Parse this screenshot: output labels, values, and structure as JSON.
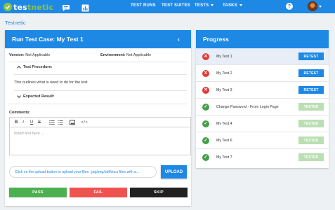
{
  "app": {
    "logo_prefix": "tes",
    "logo_suffix": "tnetic"
  },
  "nav": {
    "items": [
      {
        "label": "TEST RUNS"
      },
      {
        "label": "TEST SUITES"
      },
      {
        "label": "TESTS"
      },
      {
        "label": "TASKS"
      }
    ],
    "icons": [
      "chat-icon",
      "chart-icon",
      "help-icon",
      "avatar"
    ]
  },
  "breadcrumb": "Testnetic",
  "run": {
    "title": "Run Test Case: My Test 1",
    "version_label": "Version:",
    "version_value": "Not Applicable",
    "environment_label": "Environment:",
    "environment_value": "Not Applicable",
    "procedure_heading": "Test Procedure:",
    "procedure_text": "This outlines what is need to do for the test",
    "expected_heading": "Expected Result:",
    "comments_label": "Comments:",
    "editor_placeholder": "Insert text here ...",
    "upload_hint": "Click on the upload button to upload your files. .jpg/png/pdf/docx files with a...",
    "upload_label": "UPLOAD",
    "pass_label": "PASS",
    "fail_label": "FAIL",
    "skip_label": "SKIP"
  },
  "toolbar": {
    "bold": "B",
    "italic": "I",
    "underline": "U",
    "strike": "S",
    "code": "</>"
  },
  "progress": {
    "title": "Progress",
    "items": [
      {
        "name": "My Test 1",
        "status": "fail",
        "action": "RETEST"
      },
      {
        "name": "My Test 2",
        "status": "fail",
        "action": "RETEST"
      },
      {
        "name": "My Test 3",
        "status": "fail",
        "action": "RETEST"
      },
      {
        "name": "Change Password - From Login Page",
        "status": "pass",
        "action": "TESTED"
      },
      {
        "name": "My Test 4",
        "status": "pass",
        "action": "TESTED"
      },
      {
        "name": "My Test 6",
        "status": "pass",
        "action": "TESTED"
      },
      {
        "name": "My Test 7",
        "status": "pass",
        "action": "TESTED"
      }
    ]
  },
  "colors": {
    "primary": "#1e88e5",
    "logo_green": "#8bc34a",
    "pass": "#4caf50",
    "fail": "#ef5350",
    "skip": "#212121",
    "tested": "#b9dfb3"
  }
}
